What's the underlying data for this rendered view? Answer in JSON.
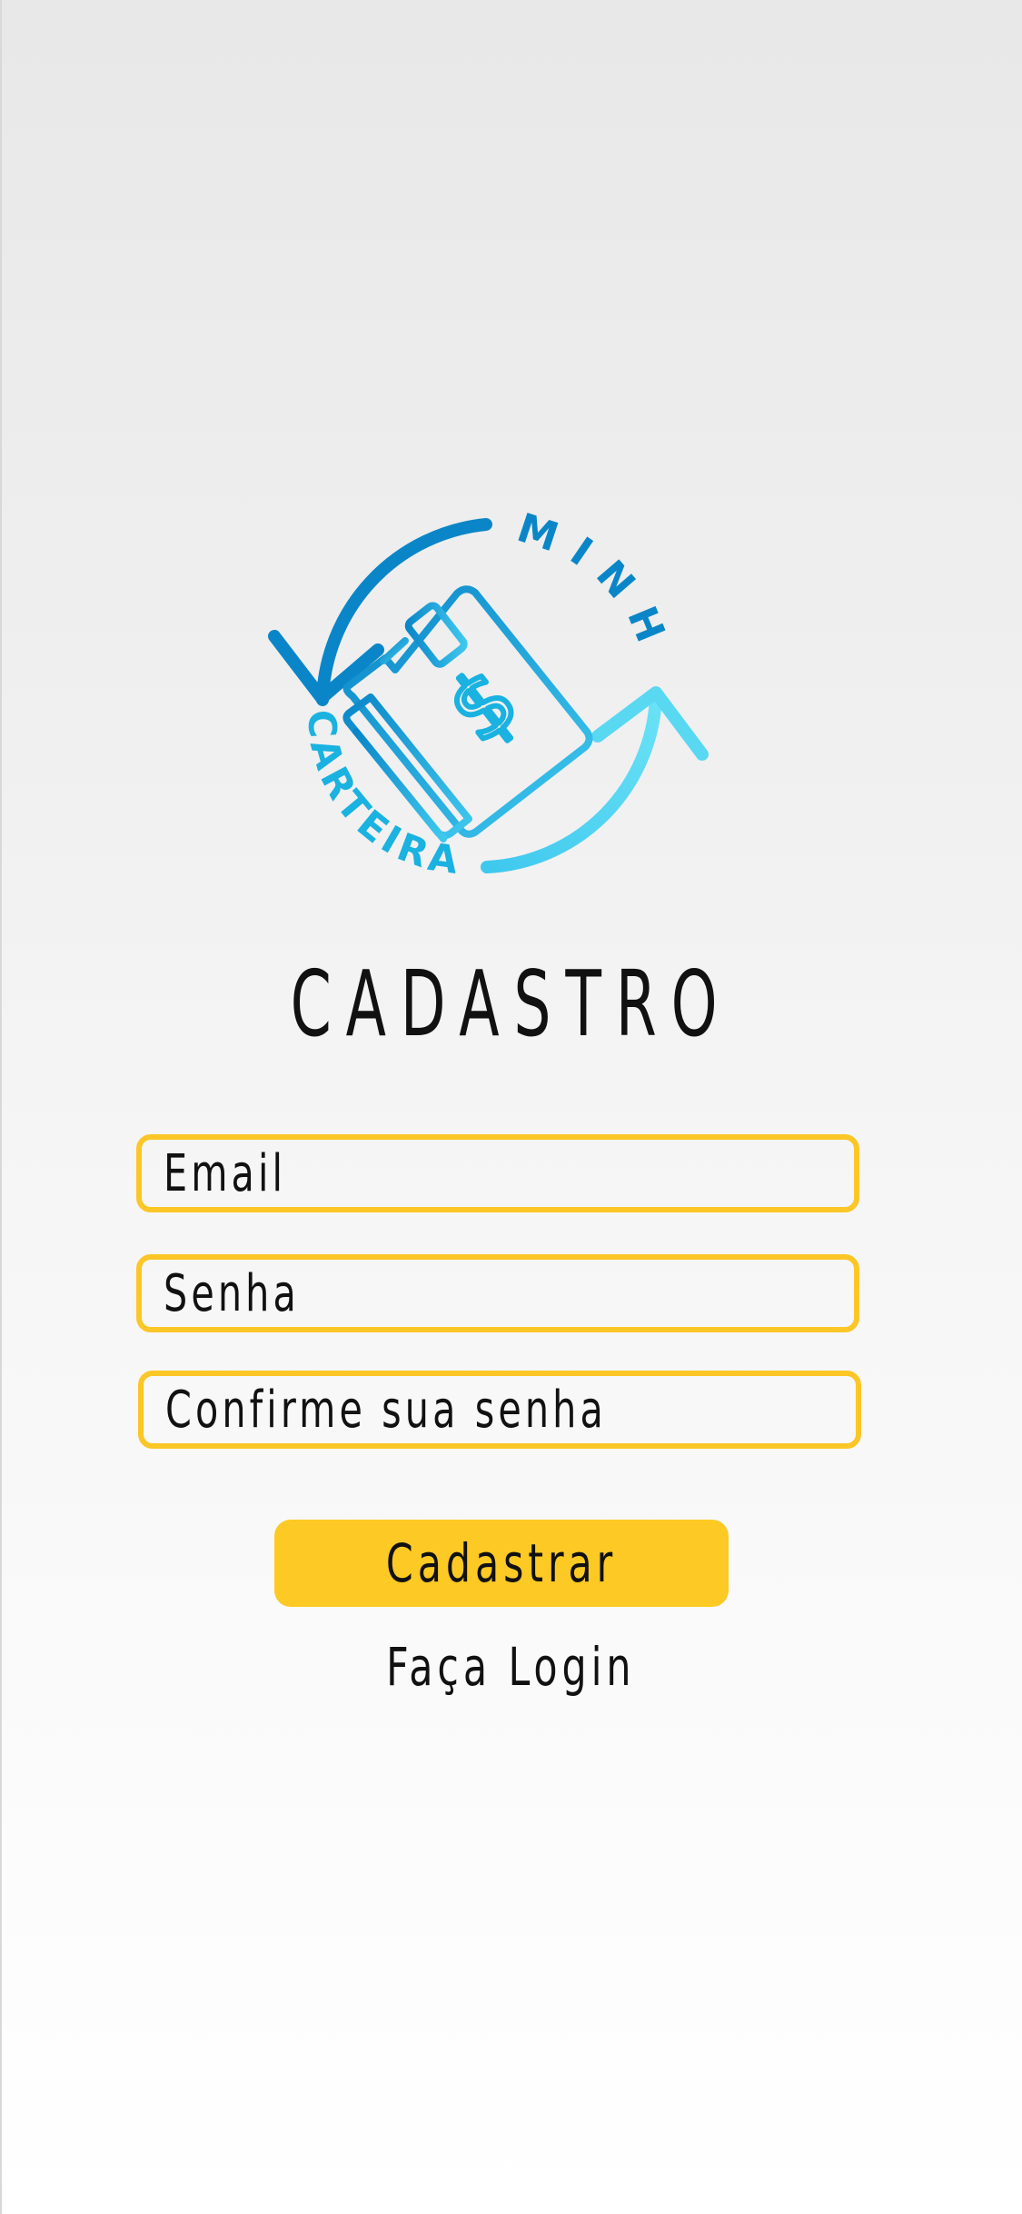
{
  "logo": {
    "text_top": "MINHA",
    "text_bottom": "CARTEIRA",
    "icon": "wallet-dollar-icon",
    "colors": {
      "dark_blue": "#0a86c8",
      "light_blue": "#5fdcf3",
      "mid_blue": "#1ab2e0"
    }
  },
  "title": "CADASTRO",
  "form": {
    "email_placeholder": "Email",
    "password_placeholder": "Senha",
    "confirm_placeholder": "Confirme sua senha"
  },
  "submit_label": "Cadastrar",
  "login_link": "Faça Login",
  "colors": {
    "accent": "#fcc626",
    "text": "#111111"
  }
}
